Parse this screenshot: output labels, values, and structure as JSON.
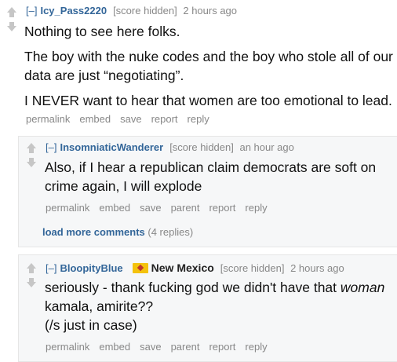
{
  "comments": [
    {
      "toggle": "[–]",
      "author": "Icy_Pass2220",
      "score": "[score hidden]",
      "time": "2 hours ago",
      "paragraphs": [
        "Nothing to see here folks.",
        "The boy with the nuke codes and the boy who stole all of our data are just “negotiating”.",
        "I NEVER want to hear that women are too emotional to lead."
      ],
      "actions": [
        "permalink",
        "embed",
        "save",
        "report",
        "reply"
      ]
    },
    {
      "toggle": "[–]",
      "author": "InsomniaticWanderer",
      "score": "[score hidden]",
      "time": "an hour ago",
      "paragraphs": [
        "Also, if I hear a republican claim democrats are soft on crime again, I will explode"
      ],
      "actions": [
        "permalink",
        "embed",
        "save",
        "parent",
        "report",
        "reply"
      ]
    },
    {
      "toggle": "[–]",
      "author": "BloopityBlue",
      "flair": "New Mexico",
      "score": "[score hidden]",
      "time": "2 hours ago",
      "line1_pre": "seriously - thank fucking god we didn't have that ",
      "line1_em": "woman",
      "line2": "kamala, amirite??",
      "line3": "(/s just in case)",
      "actions": [
        "permalink",
        "embed",
        "save",
        "parent",
        "report",
        "reply"
      ]
    }
  ],
  "load_more": {
    "label": "load more comments",
    "count": "(4 replies)"
  }
}
